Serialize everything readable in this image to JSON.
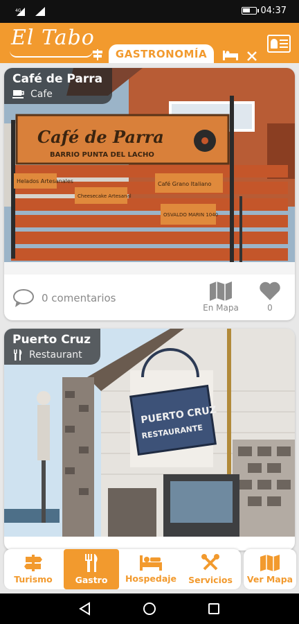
{
  "status_bar": {
    "time": "04:37"
  },
  "header": {
    "logo": "El Tabo",
    "active_tab": "GASTRONOMÍA"
  },
  "cards": [
    {
      "name": "Café de Parra",
      "category": "Cafe",
      "comments": "0 comentarios",
      "map_label": "En Mapa",
      "likes": "0",
      "sign": {
        "main": "Café de Parra",
        "sub": "BARRIO PUNTA DEL LACHO",
        "boards": [
          "Helados Artesanales",
          "Cheesecake Artesanal",
          "Café Grano Italiano",
          "OSVALDO MARIN 1040"
        ]
      }
    },
    {
      "name": "Puerto Cruz",
      "category": "Restaurant",
      "sign": {
        "line1": "PUERTO CRUZ",
        "line2": "RESTAURANTE"
      }
    }
  ],
  "bottom_nav": {
    "items": [
      {
        "label": "Turismo"
      },
      {
        "label": "Gastro"
      },
      {
        "label": "Hospedaje"
      },
      {
        "label": "Servicios"
      }
    ],
    "map_button": "Ver Mapa"
  },
  "colors": {
    "accent": "#f29a2e",
    "card_bg": "#ffffff",
    "muted": "#8a8a8a"
  }
}
